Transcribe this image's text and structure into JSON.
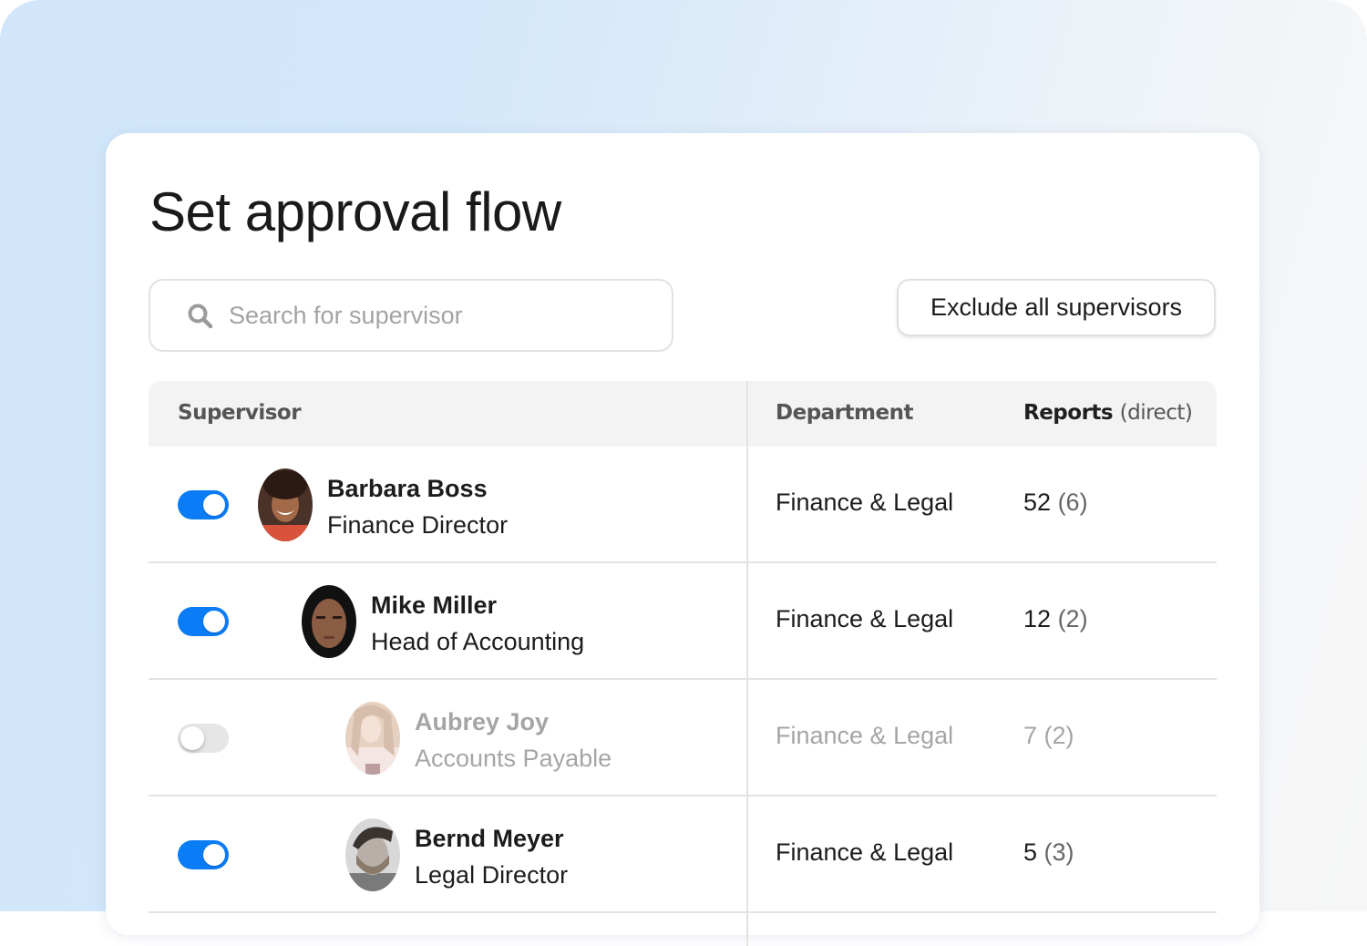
{
  "title": "Set approval flow",
  "search": {
    "placeholder": "Search for supervisor",
    "value": ""
  },
  "actions": {
    "exclude_label": "Exclude all supervisors"
  },
  "table": {
    "headers": {
      "supervisor": "Supervisor",
      "department": "Department",
      "reports": "Reports",
      "reports_sub": "(direct)"
    },
    "rows": [
      {
        "name": "Barbara Boss",
        "role": "Finance Director",
        "department": "Finance & Legal",
        "reports": "52",
        "direct": "(6)",
        "enabled": true,
        "avatar": "photo-barbara"
      },
      {
        "name": "Mike Miller",
        "role": "Head of Accounting",
        "department": "Finance & Legal",
        "reports": "12",
        "direct": "(2)",
        "enabled": true,
        "avatar": "photo-mike"
      },
      {
        "name": "Aubrey Joy",
        "role": "Accounts Payable",
        "department": "Finance & Legal",
        "reports": "7",
        "direct": "(2)",
        "enabled": false,
        "avatar": "photo-aubrey"
      },
      {
        "name": "Bernd Meyer",
        "role": "Legal Director",
        "department": "Finance & Legal",
        "reports": "5",
        "direct": "(3)",
        "enabled": true,
        "avatar": "photo-bernd"
      }
    ]
  },
  "colors": {
    "accent": "#0a7cf5",
    "toggle_off": "#e6e6e6",
    "header_bg": "#f3f3f3"
  }
}
